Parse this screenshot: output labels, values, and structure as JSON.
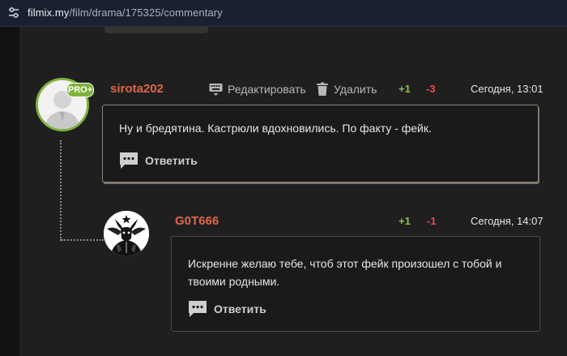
{
  "browser": {
    "url_host": "filmix.my",
    "url_path": "/film/drama/175325/commentary"
  },
  "comments": [
    {
      "author": "sirota202",
      "badge": "PRO+",
      "edit_label": "Редактировать",
      "delete_label": "Удалить",
      "votes_up": "+1",
      "votes_down": "-3",
      "time": "Сегодня, 13:01",
      "text": "Ну и бредятина. Кастрюли вдохновились. По факту - фейк.",
      "reply_label": "Ответить"
    },
    {
      "author": "G0T666",
      "votes_up": "+1",
      "votes_down": "-1",
      "time": "Сегодня, 14:07",
      "text": "Искренне желаю тебе, чтоб этот фейк произошел с тобой и твоими родными.",
      "reply_label": "Ответить"
    }
  ],
  "colors": {
    "author": "#e0664a",
    "pro_badge": "#7fb13e",
    "vote_up": "#8bc34a",
    "vote_down": "#f04a4a"
  },
  "icons": [
    "site-settings-icon",
    "keyboard-icon",
    "trash-icon",
    "speech-bubble-icon",
    "default-user-avatar",
    "baphomet-avatar"
  ]
}
